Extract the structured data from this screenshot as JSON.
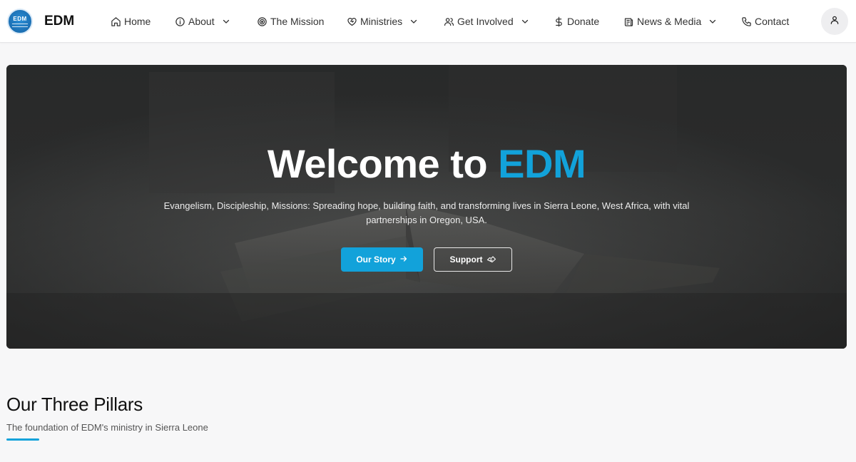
{
  "brand": {
    "logo_text": "EDM",
    "name": "EDM"
  },
  "nav": {
    "items": [
      {
        "label": "Home",
        "icon": "home-icon",
        "dropdown": false
      },
      {
        "label": "About",
        "icon": "info-icon",
        "dropdown": true
      },
      {
        "label": "The Mission",
        "icon": "target-icon",
        "dropdown": false
      },
      {
        "label": "Ministries",
        "icon": "heart-icon",
        "dropdown": true
      },
      {
        "label": "Get Involved",
        "icon": "users-icon",
        "dropdown": true
      },
      {
        "label": "Donate",
        "icon": "dollar-icon",
        "dropdown": false
      },
      {
        "label": "News & Media",
        "icon": "newspaper-icon",
        "dropdown": true
      },
      {
        "label": "Contact",
        "icon": "phone-icon",
        "dropdown": false
      }
    ],
    "account_icon": "user-icon"
  },
  "hero": {
    "title_prefix": "Welcome to ",
    "title_accent": "EDM",
    "subtitle": "Evangelism, Discipleship, Missions: Spreading hope, building faith, and transforming lives in Sierra Leone, West Africa, with vital partnerships in Oregon, USA.",
    "primary_button": "Our Story",
    "secondary_button": "Support"
  },
  "pillars": {
    "title": "Our Three Pillars",
    "subtitle": "The foundation of EDM's ministry in Sierra Leone"
  },
  "colors": {
    "accent": "#12a2da",
    "hero_bg": "#3a3b3b",
    "page_bg": "#f7f7f8"
  }
}
